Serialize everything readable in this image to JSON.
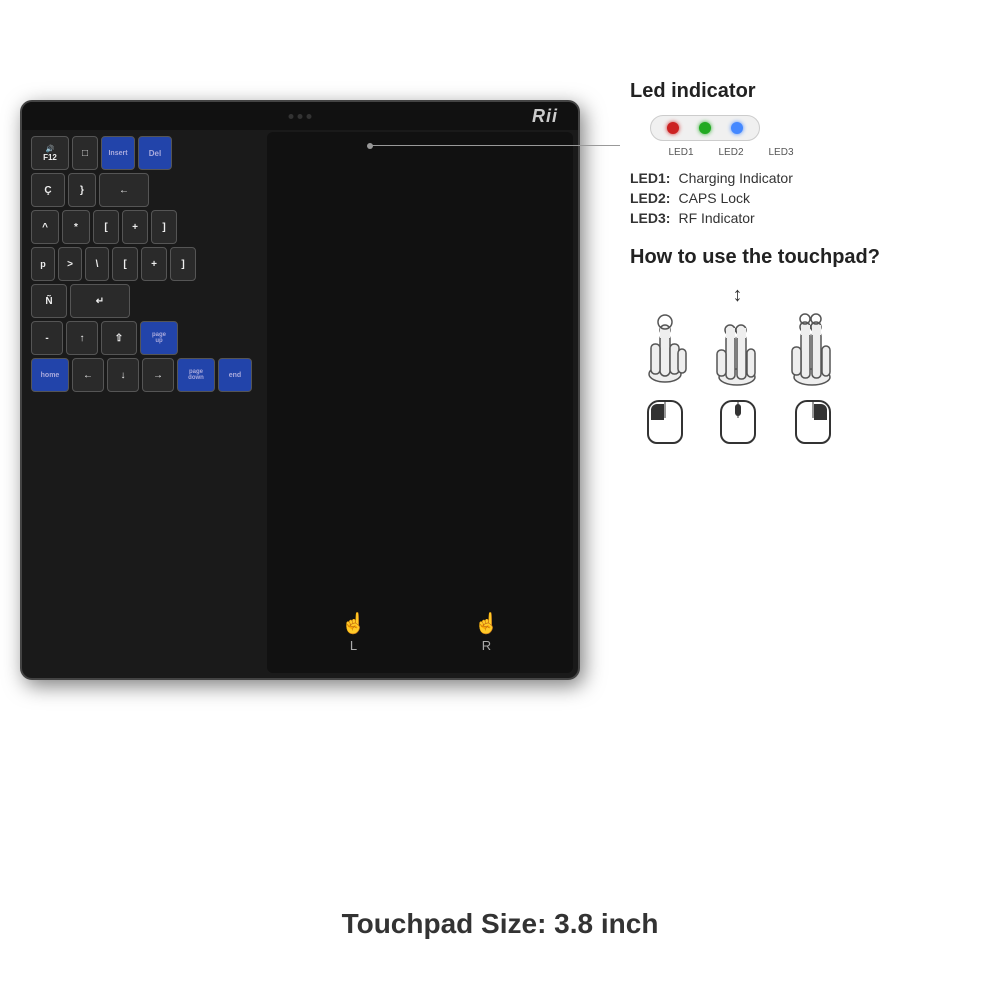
{
  "brand": "Rii",
  "keyboard": {
    "led_dots": [
      "dot1",
      "dot2",
      "dot3"
    ],
    "touchpad": {
      "left_label": "L",
      "right_label": "R"
    }
  },
  "info_panel": {
    "led_section": {
      "title": "Led indicator",
      "leds": [
        {
          "id": "LED1",
          "color": "#cc2222"
        },
        {
          "id": "LED2",
          "color": "#22aa22"
        },
        {
          "id": "LED3",
          "color": "#4488ff"
        }
      ],
      "descriptions": [
        {
          "key": "LED1:",
          "value": "Charging Indicator"
        },
        {
          "key": "LED2:",
          "value": "CAPS Lock"
        },
        {
          "key": "LED3:",
          "value": "RF Indicator"
        }
      ]
    },
    "touchpad_section": {
      "title": "How to use the touchpad?",
      "gestures": [
        {
          "name": "single-tap",
          "description": "left click"
        },
        {
          "name": "two-finger-scroll",
          "description": "scroll"
        },
        {
          "name": "two-finger-tap",
          "description": "right click"
        }
      ]
    }
  },
  "footer": {
    "touchpad_size_label": "Touchpad Size: 3.8 inch"
  },
  "keys": {
    "row1": [
      "F12",
      "Insert",
      "Del"
    ],
    "row2": [
      "Ç",
      "}",
      "←"
    ],
    "row3": [
      "^",
      "*",
      "[",
      "+",
      "]"
    ],
    "row4": [
      ">",
      "\\",
      "[",
      "+",
      "]"
    ],
    "row5": [
      "Ñ",
      "↵"
    ],
    "row6": [
      "-",
      "↑",
      "⇧"
    ],
    "row7": [
      "←",
      "↓",
      "→",
      "home",
      "page down",
      "end"
    ]
  }
}
